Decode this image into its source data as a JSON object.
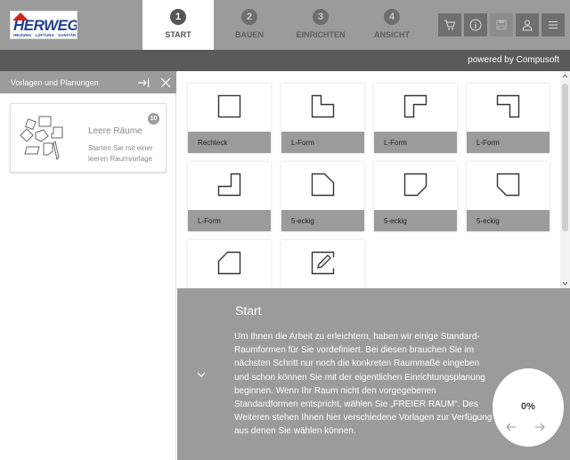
{
  "brand": {
    "name": "HERWEG",
    "tagline": "HEIZUNG · LÜFTUNG · SANITÄR"
  },
  "steps": [
    {
      "num": "1",
      "label": "START",
      "active": true
    },
    {
      "num": "2",
      "label": "BAUEN",
      "active": false
    },
    {
      "num": "3",
      "label": "EINRICHTEN",
      "active": false
    },
    {
      "num": "4",
      "label": "ANSICHT",
      "active": false
    }
  ],
  "header_icons": [
    "cart-icon",
    "info-icon",
    "save-icon",
    "user-icon",
    "menu-icon"
  ],
  "powered_by": "powered by Compusoft",
  "left_panel": {
    "title": "Vorlagen und Planungen",
    "template": {
      "title": "Leere Räume",
      "description": "Starten Sie mit einer leeren Raumvorlage",
      "count": "10"
    }
  },
  "shapes": [
    {
      "label": "Rechteck",
      "icon": "rectangle-shape-icon"
    },
    {
      "label": "L-Form",
      "icon": "l-shape-icon"
    },
    {
      "label": "L-Form",
      "icon": "l-shape-icon"
    },
    {
      "label": "L-Form",
      "icon": "l-shape-icon"
    },
    {
      "label": "L-Form",
      "icon": "l-shape-icon"
    },
    {
      "label": "5-eckig",
      "icon": "pentagon-shape-icon"
    },
    {
      "label": "5-eckig",
      "icon": "pentagon-shape-icon"
    },
    {
      "label": "5-eckig",
      "icon": "pentagon-shape-icon"
    },
    {
      "label": "",
      "icon": "pentagon-shape-icon"
    },
    {
      "label": "",
      "icon": "free-room-edit-icon"
    }
  ],
  "info": {
    "title": "Start",
    "text": "Um Ihnen die Arbeit zu erleichtern, haben wir einige Standard-Raumformen für Sie vordefiniert. Bei diesen brauchen Sie im nächsten Schritt nur noch die konkreten Raummaße eingeben und schon können Sie mit der eigentlichen Einrichtungsplanung beginnen. Wenn Ihr Raum nicht den vorgegebenen Standardformen entspricht, wählen Sie „FREIER RAUM“. Des Weiteren stehen Ihnen hier verschiedene Vorlagen zur Verfügung aus denen Sie wählen können."
  },
  "progress": {
    "value": "0%"
  },
  "colors": {
    "header": "#9b9b9b",
    "powered_bar": "#5a5a5a",
    "label_bar": "#9b9b9b",
    "brand_blue": "#1f3f8f",
    "brand_red": "#d7261e"
  }
}
